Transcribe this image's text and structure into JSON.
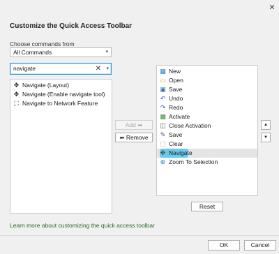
{
  "dialog": {
    "close_glyph": "✕",
    "title": "Customize the Quick Access Toolbar",
    "choose_label": "Choose commands from",
    "source_select": {
      "value": "All Commands",
      "caret": "▾"
    },
    "search": {
      "value": "navigate",
      "clear_glyph": "✕",
      "caret": "▾"
    },
    "available_commands": [
      {
        "label": "Navigate (Layout)",
        "icon": "navigate-icon",
        "glyph": "✥"
      },
      {
        "label": "Navigate (Enable navigate tool)",
        "icon": "navigate-icon",
        "glyph": "✥"
      },
      {
        "label": "Navigate to Network Feature",
        "icon": "network-feature-icon",
        "glyph": "⛶"
      }
    ],
    "toolbar_commands": [
      {
        "label": "New",
        "icon": "new-project-icon",
        "glyph": "▦",
        "color": "#2b7cd3"
      },
      {
        "label": "Open",
        "icon": "open-folder-icon",
        "glyph": "▭",
        "color": "#d9a41e"
      },
      {
        "label": "Save",
        "icon": "save-icon",
        "glyph": "▣",
        "color": "#3a6fb5"
      },
      {
        "label": "Undo",
        "icon": "undo-icon",
        "glyph": "↶",
        "color": "#2e62b8"
      },
      {
        "label": "Redo",
        "icon": "redo-icon",
        "glyph": "↷",
        "color": "#2e62b8"
      },
      {
        "label": "Activate",
        "icon": "activate-icon",
        "glyph": "▩",
        "color": "#3c8a3c"
      },
      {
        "label": "Close Activation",
        "icon": "close-activation-icon",
        "glyph": "◫",
        "color": "#555555"
      },
      {
        "label": "Save",
        "icon": "save-edits-icon",
        "glyph": "✎",
        "color": "#4a4a9a"
      },
      {
        "label": "Clear",
        "icon": "clear-selection-icon",
        "glyph": "⬚",
        "color": "#666666"
      },
      {
        "label": "Navigate",
        "icon": "navigate-icon",
        "glyph": "✥",
        "color": "#444444"
      },
      {
        "label": "Zoom To Selection",
        "icon": "zoom-to-selection-icon",
        "glyph": "⊕",
        "color": "#2b7cd3"
      }
    ],
    "selected_index": 9,
    "add_label": "Add ➡",
    "remove_label": "⬅ Remove",
    "up_glyph": "▲",
    "down_glyph": "▼",
    "reset_label": "Reset",
    "learn_more_link": "Learn more about customizing the quick access toolbar",
    "ok_label": "OK",
    "cancel_label": "Cancel",
    "highlight_color": "#5cc6ea"
  }
}
